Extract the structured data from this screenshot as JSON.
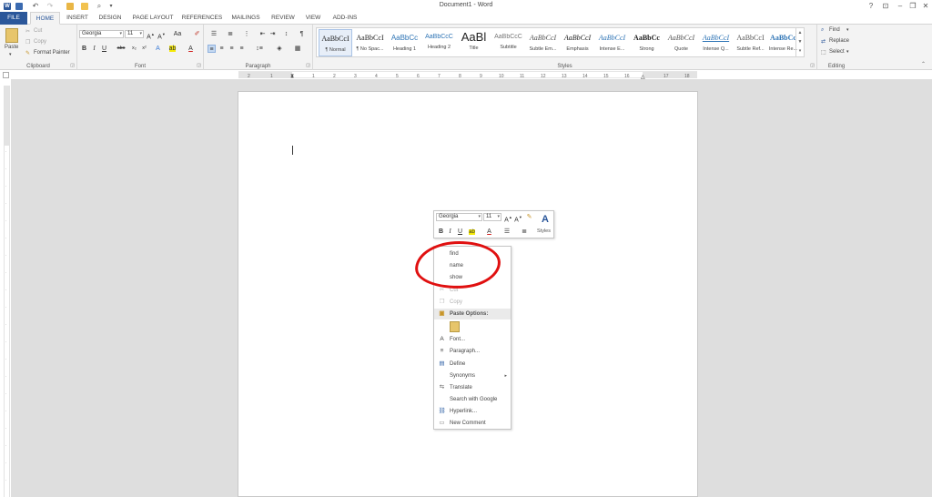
{
  "window": {
    "title": "Document1 - Word",
    "controls": [
      "?",
      "⊡",
      "–",
      "❐",
      "✕"
    ]
  },
  "quick_access": [
    "word-logo-icon",
    "save-icon",
    "undo-icon",
    "redo-icon",
    "open-icon",
    "folder-icon",
    "print-preview-icon",
    "customize-icon"
  ],
  "tabs": [
    {
      "label": "FILE"
    },
    {
      "label": "HOME"
    },
    {
      "label": "INSERT"
    },
    {
      "label": "DESIGN"
    },
    {
      "label": "PAGE LAYOUT"
    },
    {
      "label": "REFERENCES"
    },
    {
      "label": "MAILINGS"
    },
    {
      "label": "REVIEW"
    },
    {
      "label": "VIEW"
    },
    {
      "label": "ADD-INS"
    }
  ],
  "ribbon": {
    "clipboard": {
      "label": "Clipboard",
      "paste": "Paste",
      "cut": "Cut",
      "copy": "Copy",
      "format_painter": "Format Painter"
    },
    "font": {
      "label": "Font",
      "font_name": "Georgia",
      "font_size": "11",
      "change_case": "Aa"
    },
    "paragraph": {
      "label": "Paragraph"
    },
    "styles": {
      "label": "Styles",
      "items": [
        {
          "sample": "AaBbCcI",
          "name": "¶ Normal"
        },
        {
          "sample": "AaBbCcI",
          "name": "¶ No Spac..."
        },
        {
          "sample": "AaBbCc",
          "name": "Heading 1"
        },
        {
          "sample": "AaBbCcC",
          "name": "Heading 2"
        },
        {
          "sample": "AaBl",
          "name": "Title"
        },
        {
          "sample": "AaBbCcC",
          "name": "Subtitle"
        },
        {
          "sample": "AaBbCcI",
          "name": "Subtle Em..."
        },
        {
          "sample": "AaBbCcI",
          "name": "Emphasis"
        },
        {
          "sample": "AaBbCcI",
          "name": "Intense E..."
        },
        {
          "sample": "AaBbCc",
          "name": "Strong"
        },
        {
          "sample": "AaBbCcI",
          "name": "Quote"
        },
        {
          "sample": "AaBbCcI",
          "name": "Intense Q..."
        },
        {
          "sample": "AaBbCcI",
          "name": "Subtle Ref..."
        },
        {
          "sample": "AaBbCc",
          "name": "Intense Re..."
        }
      ]
    },
    "editing": {
      "label": "Editing",
      "find": "Find",
      "replace": "Replace",
      "select": "Select"
    }
  },
  "ruler_numbers": [
    "2",
    "1",
    "1",
    "2",
    "3",
    "4",
    "5",
    "6",
    "7",
    "8",
    "9",
    "10",
    "11",
    "12",
    "13",
    "14",
    "15",
    "16",
    "17",
    "18"
  ],
  "mini_toolbar": {
    "font_name": "Georgia",
    "font_size": "11",
    "styles_label": "Styles"
  },
  "context_menu": {
    "custom_items": [
      "find",
      "name",
      "show"
    ],
    "cut": "Cut",
    "copy": "Copy",
    "paste_options": "Paste Options:",
    "items": [
      {
        "label": "Font...",
        "icon": "font-icon"
      },
      {
        "label": "Paragraph...",
        "icon": "paragraph-icon"
      },
      {
        "label": "Define",
        "icon": "define-icon"
      },
      {
        "label": "Synonyms",
        "icon": "",
        "submenu": true
      },
      {
        "label": "Translate",
        "icon": "translate-icon"
      },
      {
        "label": "Search with Google",
        "icon": ""
      },
      {
        "label": "Hyperlink...",
        "icon": "hyperlink-icon"
      },
      {
        "label": "New Comment",
        "icon": "new-comment-icon"
      }
    ]
  },
  "colors": {
    "accent": "#2b579a",
    "annotation": "#e01010",
    "highlight": "#f5e90a",
    "font_color": "#d0201e"
  }
}
